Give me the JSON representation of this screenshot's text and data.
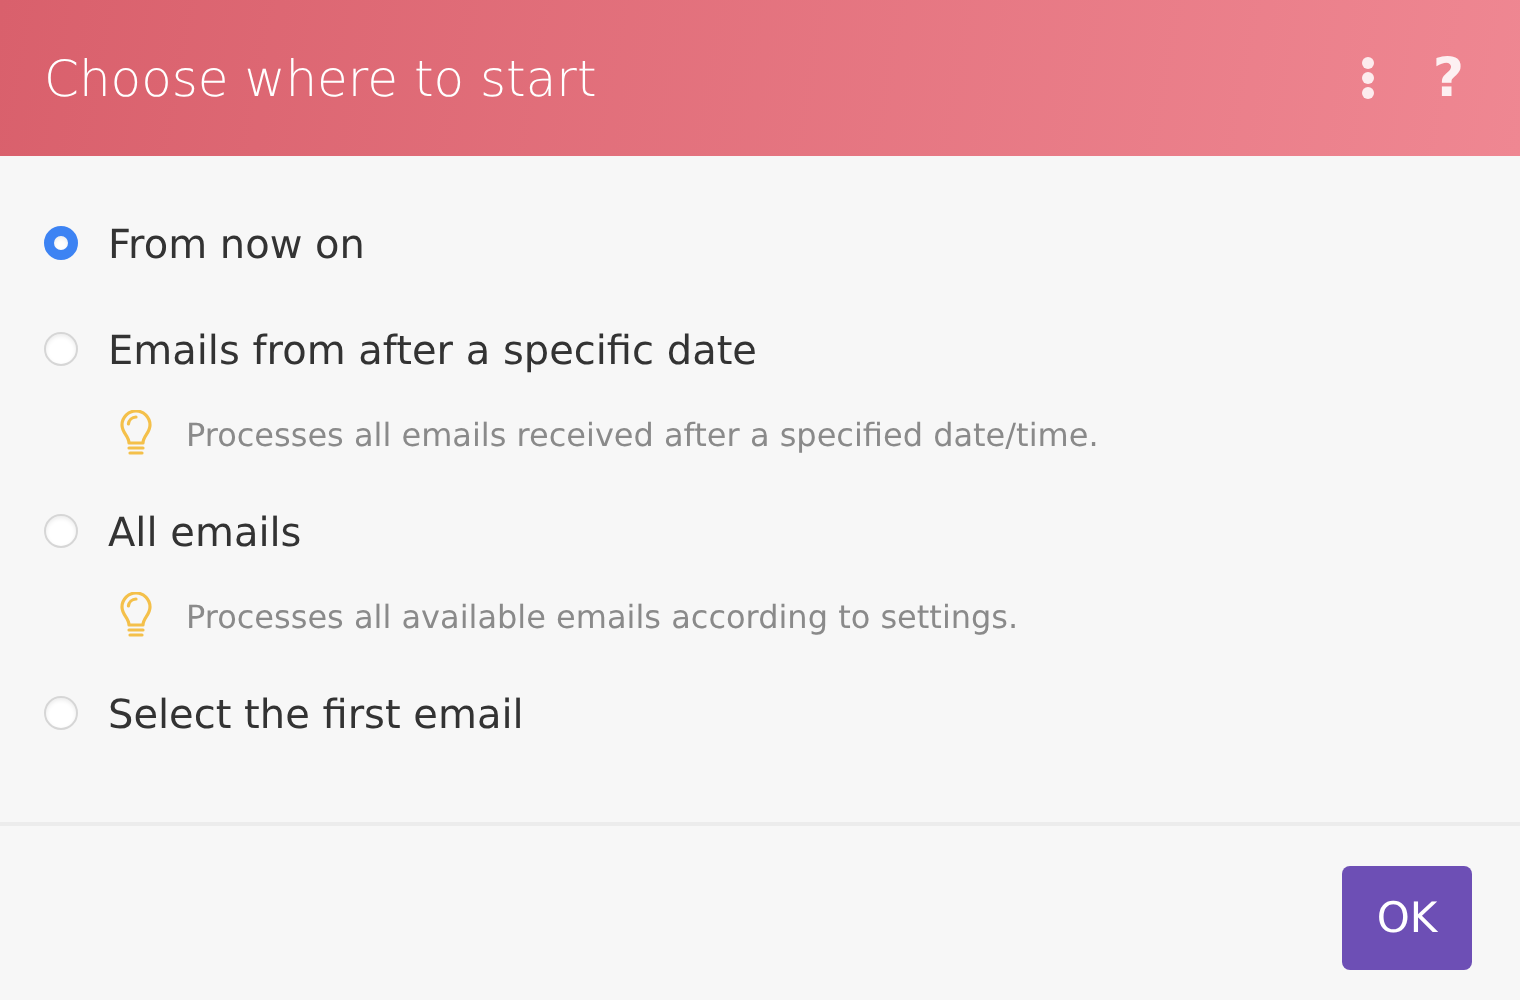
{
  "window": {
    "title": "Choose where to start",
    "help": "?"
  },
  "options": [
    {
      "label": "From now on",
      "selected": true
    },
    {
      "label": "Emails from after a specific date",
      "selected": false,
      "hint": "Processes all emails received after a specified date/time."
    },
    {
      "label": "All emails",
      "selected": false,
      "hint": "Processes all available emails according to settings."
    },
    {
      "label": "Select the first email",
      "selected": false
    }
  ],
  "buttons": [
    "OK"
  ]
}
